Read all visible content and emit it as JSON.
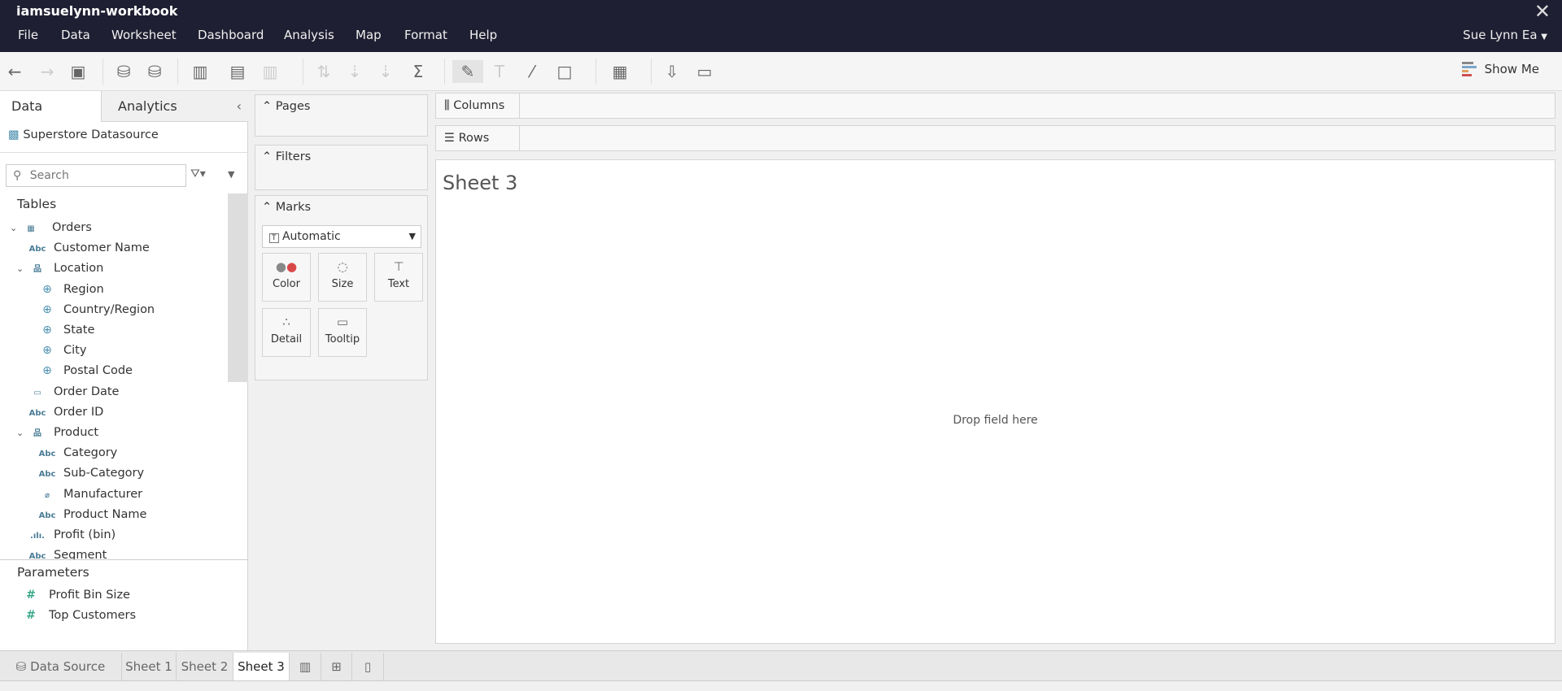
{
  "window": {
    "title": "iamsuelynn-workbook",
    "user": "Sue Lynn Ea"
  },
  "menu": [
    "File",
    "Data",
    "Worksheet",
    "Dashboard",
    "Analysis",
    "Map",
    "Format",
    "Help"
  ],
  "toolbar": {
    "show_me": "Show Me"
  },
  "left": {
    "tabs": {
      "data": "Data",
      "analytics": "Analytics"
    },
    "datasource": "Superstore Datasource",
    "search_placeholder": "Search",
    "tables_label": "Tables",
    "fields": [
      {
        "label": "Orders",
        "icon": "table-icon",
        "glyph": "▦",
        "level": 0,
        "expand": true
      },
      {
        "label": "Customer Name",
        "icon": "string-icon",
        "glyph": "Abc",
        "level": 1
      },
      {
        "label": "Location",
        "icon": "hierarchy-icon",
        "glyph": "品",
        "level": 1,
        "expand": true
      },
      {
        "label": "Region",
        "icon": "globe-icon",
        "glyph": "⊕",
        "level": 2
      },
      {
        "label": "Country/Region",
        "icon": "globe-icon",
        "glyph": "⊕",
        "level": 2
      },
      {
        "label": "State",
        "icon": "globe-icon",
        "glyph": "⊕",
        "level": 2
      },
      {
        "label": "City",
        "icon": "globe-icon",
        "glyph": "⊕",
        "level": 2
      },
      {
        "label": "Postal Code",
        "icon": "globe-icon",
        "glyph": "⊕",
        "level": 2
      },
      {
        "label": "Order Date",
        "icon": "calendar-icon",
        "glyph": "▭",
        "level": 1
      },
      {
        "label": "Order ID",
        "icon": "string-icon",
        "glyph": "Abc",
        "level": 1
      },
      {
        "label": "Product",
        "icon": "hierarchy-icon",
        "glyph": "品",
        "level": 1,
        "expand": true
      },
      {
        "label": "Category",
        "icon": "string-icon",
        "glyph": "Abc",
        "level": 2
      },
      {
        "label": "Sub-Category",
        "icon": "string-icon",
        "glyph": "Abc",
        "level": 2
      },
      {
        "label": "Manufacturer",
        "icon": "paperclip-icon",
        "glyph": "⌀",
        "level": 2
      },
      {
        "label": "Product Name",
        "icon": "string-icon",
        "glyph": "Abc",
        "level": 2
      },
      {
        "label": "Profit (bin)",
        "icon": "bin-icon",
        "glyph": ".ılı.",
        "level": 1
      },
      {
        "label": "Segment",
        "icon": "string-icon",
        "glyph": "Abc",
        "level": 1
      }
    ],
    "parameters_label": "Parameters",
    "parameters": [
      "Profit Bin Size",
      "Top Customers"
    ]
  },
  "cards": {
    "pages": "Pages",
    "filters": "Filters",
    "marks": "Marks",
    "mark_type": "Automatic",
    "mark_buttons": [
      "Color",
      "Size",
      "Text",
      "Detail",
      "Tooltip"
    ]
  },
  "shelves": {
    "columns": "Columns",
    "rows": "Rows"
  },
  "sheet": {
    "title": "Sheet 3",
    "drop_hint": "Drop field here"
  },
  "bottom_tabs": {
    "data_source": "Data Source",
    "sheets": [
      "Sheet 1",
      "Sheet 2",
      "Sheet 3"
    ],
    "active": "Sheet 3"
  }
}
